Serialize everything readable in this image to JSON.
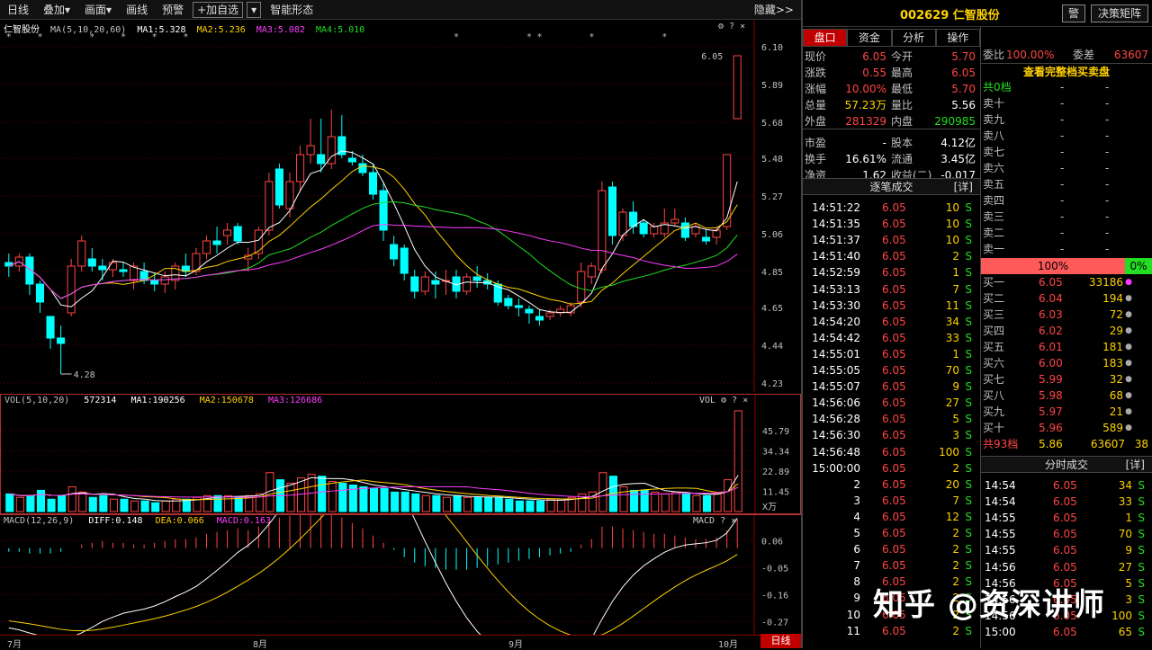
{
  "toolbar": {
    "items": [
      "日线",
      "叠加▾",
      "画面▾",
      "画线",
      "预警",
      "+加自选",
      "▾",
      "智能形态"
    ],
    "hide_label": "隐藏>>"
  },
  "kline": {
    "stock_name": "仁智股份",
    "ma_params": "MA(5,10,20,60)",
    "ma1": "MA1:5.328",
    "ma2": "MA2:5.236",
    "ma3": "MA3:5.082",
    "ma4": "MA4:5.010",
    "price_ticks": [
      "6.10",
      "5.89",
      "5.68",
      "5.48",
      "5.27",
      "5.06",
      "4.85",
      "4.65",
      "4.44",
      "4.23"
    ],
    "high_label": "6.05",
    "low_label": "4.28"
  },
  "volume": {
    "params": "VOL(5,10,20)",
    "value": "572314",
    "ma1": "MA1:190256",
    "ma2": "MA2:150678",
    "ma3": "MA3:126686",
    "label": "VOL",
    "ticks": [
      "45.79",
      "34.34",
      "22.89",
      "11.45"
    ],
    "unit": "X万"
  },
  "macd": {
    "params": "MACD(12,26,9)",
    "diff": "DIFF:0.148",
    "dea": "DEA:0.066",
    "macd": "MACD:0.163",
    "label": "MACD",
    "ticks": [
      "0.06",
      "-0.05",
      "-0.16",
      "-0.27"
    ]
  },
  "xaxis": {
    "months": [
      "7月",
      "8月",
      "9月",
      "10月"
    ],
    "period_tab": "日线"
  },
  "colors": {
    "up": "#ff4444",
    "down": "#00ffff",
    "ma1": "#ffffff",
    "ma2": "#ffd200",
    "ma3": "#ff3bff",
    "ma4": "#22dd22"
  },
  "header": {
    "code_name": "002629 仁智股份",
    "alert_btn": "警",
    "decision_btn": "决策矩阵"
  },
  "tabs": [
    "盘口",
    "资金",
    "分析",
    "操作"
  ],
  "quote": [
    {
      "l1": "现价",
      "v1": "6.05",
      "c1": "red",
      "l2": "今开",
      "v2": "5.70",
      "c2": "red"
    },
    {
      "l1": "涨跌",
      "v1": "0.55",
      "c1": "red",
      "l2": "最高",
      "v2": "6.05",
      "c2": "red"
    },
    {
      "l1": "涨幅",
      "v1": "10.00%",
      "c1": "red",
      "l2": "最低",
      "v2": "5.70",
      "c2": "red"
    },
    {
      "l1": "总量",
      "v1": "57.23万",
      "c1": "yel",
      "l2": "量比",
      "v2": "5.56",
      "c2": "wht"
    },
    {
      "l1": "外盘",
      "v1": "281329",
      "c1": "red",
      "l2": "内盘",
      "v2": "290985",
      "c2": "grn"
    },
    {
      "l1": "市盈",
      "v1": "-",
      "c1": "wht",
      "l2": "股本",
      "v2": "4.12亿",
      "c2": "wht"
    },
    {
      "l1": "换手",
      "v1": "16.61%",
      "c1": "wht",
      "l2": "流通",
      "v2": "3.45亿",
      "c2": "wht"
    },
    {
      "l1": "净资",
      "v1": "1.62",
      "c1": "wht",
      "l2": "收益(二)",
      "v2": "-0.017",
      "c2": "wht"
    }
  ],
  "ticks_title": "逐笔成交",
  "ticks_detail": "[详]",
  "ticks": [
    {
      "t": "14:51:22",
      "p": "6.05",
      "v": "10",
      "s": "S"
    },
    {
      "t": "14:51:35",
      "p": "6.05",
      "v": "10",
      "s": "S"
    },
    {
      "t": "14:51:37",
      "p": "6.05",
      "v": "10",
      "s": "S"
    },
    {
      "t": "14:51:40",
      "p": "6.05",
      "v": "2",
      "s": "S"
    },
    {
      "t": "14:52:59",
      "p": "6.05",
      "v": "1",
      "s": "S"
    },
    {
      "t": "14:53:13",
      "p": "6.05",
      "v": "7",
      "s": "S"
    },
    {
      "t": "14:53:30",
      "p": "6.05",
      "v": "11",
      "s": "S"
    },
    {
      "t": "14:54:20",
      "p": "6.05",
      "v": "34",
      "s": "S"
    },
    {
      "t": "14:54:42",
      "p": "6.05",
      "v": "33",
      "s": "S"
    },
    {
      "t": "14:55:01",
      "p": "6.05",
      "v": "1",
      "s": "S"
    },
    {
      "t": "14:55:05",
      "p": "6.05",
      "v": "70",
      "s": "S"
    },
    {
      "t": "14:55:07",
      "p": "6.05",
      "v": "9",
      "s": "S"
    },
    {
      "t": "14:56:06",
      "p": "6.05",
      "v": "27",
      "s": "S"
    },
    {
      "t": "14:56:28",
      "p": "6.05",
      "v": "5",
      "s": "S"
    },
    {
      "t": "14:56:30",
      "p": "6.05",
      "v": "3",
      "s": "S"
    },
    {
      "t": "14:56:48",
      "p": "6.05",
      "v": "100",
      "s": "S"
    },
    {
      "t": "15:00:00",
      "p": "6.05",
      "v": "2",
      "s": "S"
    },
    {
      "t": "2",
      "p": "6.05",
      "v": "20",
      "s": "S"
    },
    {
      "t": "3",
      "p": "6.05",
      "v": "7",
      "s": "S"
    },
    {
      "t": "4",
      "p": "6.05",
      "v": "12",
      "s": "S"
    },
    {
      "t": "5",
      "p": "6.05",
      "v": "2",
      "s": "S"
    },
    {
      "t": "6",
      "p": "6.05",
      "v": "2",
      "s": "S"
    },
    {
      "t": "7",
      "p": "6.05",
      "v": "2",
      "s": "S"
    },
    {
      "t": "8",
      "p": "6.05",
      "v": "2",
      "s": "S"
    },
    {
      "t": "9",
      "p": "6.05",
      "v": "2",
      "s": "S"
    },
    {
      "t": "10",
      "p": "6.05",
      "v": "2",
      "s": "S"
    },
    {
      "t": "11",
      "p": "6.05",
      "v": "2",
      "s": "S"
    }
  ],
  "book": {
    "weibi_label": "委比",
    "weibi": "100.00%",
    "weicha_label": "委差",
    "weicha": "63607",
    "full_book": "查看完整档买卖盘",
    "sell_total_label": "共0档",
    "sells": [
      "卖十",
      "卖九",
      "卖八",
      "卖七",
      "卖六",
      "卖五",
      "卖四",
      "卖三",
      "卖二",
      "卖一"
    ],
    "buy_pct": "100%",
    "sell_pct": "0%",
    "buys": [
      {
        "l": "买一",
        "p": "6.05",
        "v": "33186"
      },
      {
        "l": "买二",
        "p": "6.04",
        "v": "194"
      },
      {
        "l": "买三",
        "p": "6.03",
        "v": "72"
      },
      {
        "l": "买四",
        "p": "6.02",
        "v": "29"
      },
      {
        "l": "买五",
        "p": "6.01",
        "v": "181"
      },
      {
        "l": "买六",
        "p": "6.00",
        "v": "183"
      },
      {
        "l": "买七",
        "p": "5.99",
        "v": "32"
      },
      {
        "l": "买八",
        "p": "5.98",
        "v": "68"
      },
      {
        "l": "买九",
        "p": "5.97",
        "v": "21"
      },
      {
        "l": "买十",
        "p": "5.96",
        "v": "589"
      }
    ],
    "buy_total_label": "共93档",
    "buy_total_price": "5.86",
    "buy_total_vol": "63607",
    "buy_total_n": "38"
  },
  "minute_title": "分时成交",
  "minute_detail": "[详]",
  "minute": [
    {
      "t": "14:54",
      "p": "6.05",
      "v": "34",
      "s": "S"
    },
    {
      "t": "14:54",
      "p": "6.05",
      "v": "33",
      "s": "S"
    },
    {
      "t": "14:55",
      "p": "6.05",
      "v": "1",
      "s": "S"
    },
    {
      "t": "14:55",
      "p": "6.05",
      "v": "70",
      "s": "S"
    },
    {
      "t": "14:55",
      "p": "6.05",
      "v": "9",
      "s": "S"
    },
    {
      "t": "14:56",
      "p": "6.05",
      "v": "27",
      "s": "S"
    },
    {
      "t": "14:56",
      "p": "6.05",
      "v": "5",
      "s": "S"
    },
    {
      "t": "14:56",
      "p": "6.05",
      "v": "3",
      "s": "S"
    },
    {
      "t": "14:56",
      "p": "6.05",
      "v": "100",
      "s": "S"
    },
    {
      "t": "15:00",
      "p": "6.05",
      "v": "65",
      "s": "S"
    }
  ],
  "watermark": "知乎 @资深讲师",
  "chart_data": {
    "type": "candlestick",
    "ohlc": [
      [
        4.9,
        4.95,
        4.82,
        4.88
      ],
      [
        4.88,
        4.95,
        4.85,
        4.93
      ],
      [
        4.93,
        4.95,
        4.72,
        4.78
      ],
      [
        4.78,
        4.8,
        4.62,
        4.68
      ],
      [
        4.6,
        4.6,
        4.42,
        4.48
      ],
      [
        4.48,
        4.55,
        4.28,
        4.45
      ],
      [
        4.62,
        4.92,
        4.6,
        4.88
      ],
      [
        4.88,
        5.05,
        4.85,
        5.02
      ],
      [
        4.92,
        4.98,
        4.85,
        4.88
      ],
      [
        4.88,
        4.92,
        4.8,
        4.86
      ],
      [
        4.86,
        4.92,
        4.82,
        4.9
      ],
      [
        4.86,
        4.9,
        4.82,
        4.85
      ],
      [
        4.8,
        4.9,
        4.75,
        4.88
      ],
      [
        4.85,
        4.9,
        4.78,
        4.8
      ],
      [
        4.8,
        4.84,
        4.74,
        4.78
      ],
      [
        4.78,
        4.85,
        4.73,
        4.82
      ],
      [
        4.8,
        4.9,
        4.75,
        4.88
      ],
      [
        4.88,
        4.95,
        4.82,
        4.85
      ],
      [
        4.85,
        4.98,
        4.83,
        4.95
      ],
      [
        4.95,
        5.05,
        4.92,
        5.02
      ],
      [
        5.02,
        5.1,
        4.95,
        5.0
      ],
      [
        5.05,
        5.12,
        5.0,
        5.08
      ],
      [
        5.1,
        5.12,
        5.0,
        5.02
      ],
      [
        4.92,
        4.98,
        4.85,
        4.94
      ],
      [
        4.95,
        5.1,
        4.92,
        5.08
      ],
      [
        5.08,
        5.4,
        5.05,
        5.35
      ],
      [
        5.42,
        5.45,
        5.2,
        5.22
      ],
      [
        5.2,
        5.4,
        5.15,
        5.35
      ],
      [
        5.35,
        5.55,
        5.3,
        5.5
      ],
      [
        5.5,
        5.7,
        5.45,
        5.55
      ],
      [
        5.5,
        5.7,
        5.4,
        5.45
      ],
      [
        5.45,
        5.75,
        5.42,
        5.6
      ],
      [
        5.6,
        5.72,
        5.48,
        5.5
      ],
      [
        5.48,
        5.52,
        5.44,
        5.46
      ],
      [
        5.45,
        5.5,
        5.38,
        5.4
      ],
      [
        5.4,
        5.45,
        5.25,
        5.28
      ],
      [
        5.3,
        5.35,
        5.02,
        5.08
      ],
      [
        5.0,
        5.05,
        4.88,
        4.92
      ],
      [
        4.98,
        5.0,
        4.8,
        4.84
      ],
      [
        4.82,
        4.86,
        4.7,
        4.74
      ],
      [
        4.74,
        4.85,
        4.72,
        4.82
      ],
      [
        4.8,
        4.85,
        4.7,
        4.78
      ],
      [
        4.8,
        4.86,
        4.72,
        4.8
      ],
      [
        4.82,
        4.86,
        4.7,
        4.74
      ],
      [
        4.74,
        4.84,
        4.72,
        4.82
      ],
      [
        4.82,
        4.88,
        4.76,
        4.8
      ],
      [
        4.8,
        4.84,
        4.75,
        4.78
      ],
      [
        4.78,
        4.8,
        4.66,
        4.68
      ],
      [
        4.7,
        4.72,
        4.64,
        4.66
      ],
      [
        4.66,
        4.7,
        4.6,
        4.65
      ],
      [
        4.64,
        4.66,
        4.56,
        4.62
      ],
      [
        4.6,
        4.64,
        4.55,
        4.58
      ],
      [
        4.6,
        4.64,
        4.58,
        4.62
      ],
      [
        4.62,
        4.66,
        4.6,
        4.64
      ],
      [
        4.62,
        4.68,
        4.6,
        4.66
      ],
      [
        4.68,
        4.9,
        4.65,
        4.85
      ],
      [
        4.82,
        4.9,
        4.78,
        4.88
      ],
      [
        4.86,
        5.35,
        4.84,
        5.3
      ],
      [
        5.32,
        5.35,
        5.0,
        5.05
      ],
      [
        5.05,
        5.2,
        5.02,
        5.18
      ],
      [
        5.18,
        5.24,
        5.06,
        5.1
      ],
      [
        5.12,
        5.14,
        5.04,
        5.06
      ],
      [
        5.06,
        5.12,
        5.04,
        5.1
      ],
      [
        5.06,
        5.2,
        5.04,
        5.12
      ],
      [
        5.12,
        5.2,
        5.1,
        5.14
      ],
      [
        5.12,
        5.15,
        5.02,
        5.04
      ],
      [
        5.06,
        5.12,
        5.04,
        5.1
      ],
      [
        5.04,
        5.08,
        5.0,
        5.02
      ],
      [
        5.04,
        5.1,
        5.0,
        5.08
      ],
      [
        5.1,
        5.5,
        5.08,
        5.5
      ],
      [
        5.7,
        6.05,
        5.7,
        6.05
      ]
    ],
    "volume": [
      10,
      8,
      9,
      12,
      7,
      9,
      14,
      11,
      8,
      9,
      7,
      7,
      6,
      6,
      5,
      6,
      7,
      7,
      8,
      9,
      9,
      9,
      8,
      9,
      10,
      22,
      18,
      16,
      19,
      21,
      20,
      17,
      16,
      15,
      14,
      13,
      13,
      11,
      11,
      10,
      9,
      9,
      8,
      9,
      8,
      8,
      8,
      8,
      7,
      6,
      6,
      6,
      7,
      7,
      8,
      10,
      11,
      22,
      20,
      14,
      12,
      12,
      11,
      10,
      11,
      10,
      9,
      9,
      10,
      18,
      57
    ],
    "macd_hist": [
      -0.02,
      -0.02,
      -0.03,
      -0.03,
      -0.03,
      -0.02,
      0.0,
      0.02,
      0.03,
      0.04,
      0.03,
      0.03,
      0.02,
      0.02,
      0.03,
      0.04,
      0.05,
      0.05,
      0.06,
      0.08,
      0.09,
      0.1,
      0.11,
      0.1,
      0.12,
      0.15,
      0.17,
      0.18,
      0.19,
      0.2,
      0.2,
      0.19,
      0.17,
      0.14,
      0.11,
      0.07,
      0.03,
      -0.01,
      -0.05,
      -0.08,
      -0.1,
      -0.11,
      -0.12,
      -0.12,
      -0.12,
      -0.11,
      -0.1,
      -0.09,
      -0.08,
      -0.07,
      -0.06,
      -0.05,
      -0.04,
      -0.03,
      -0.02,
      0.02,
      0.05,
      0.12,
      0.12,
      0.11,
      0.1,
      0.09,
      0.08,
      0.08,
      0.07,
      0.06,
      0.05,
      0.05,
      0.06,
      0.1,
      0.16
    ]
  }
}
